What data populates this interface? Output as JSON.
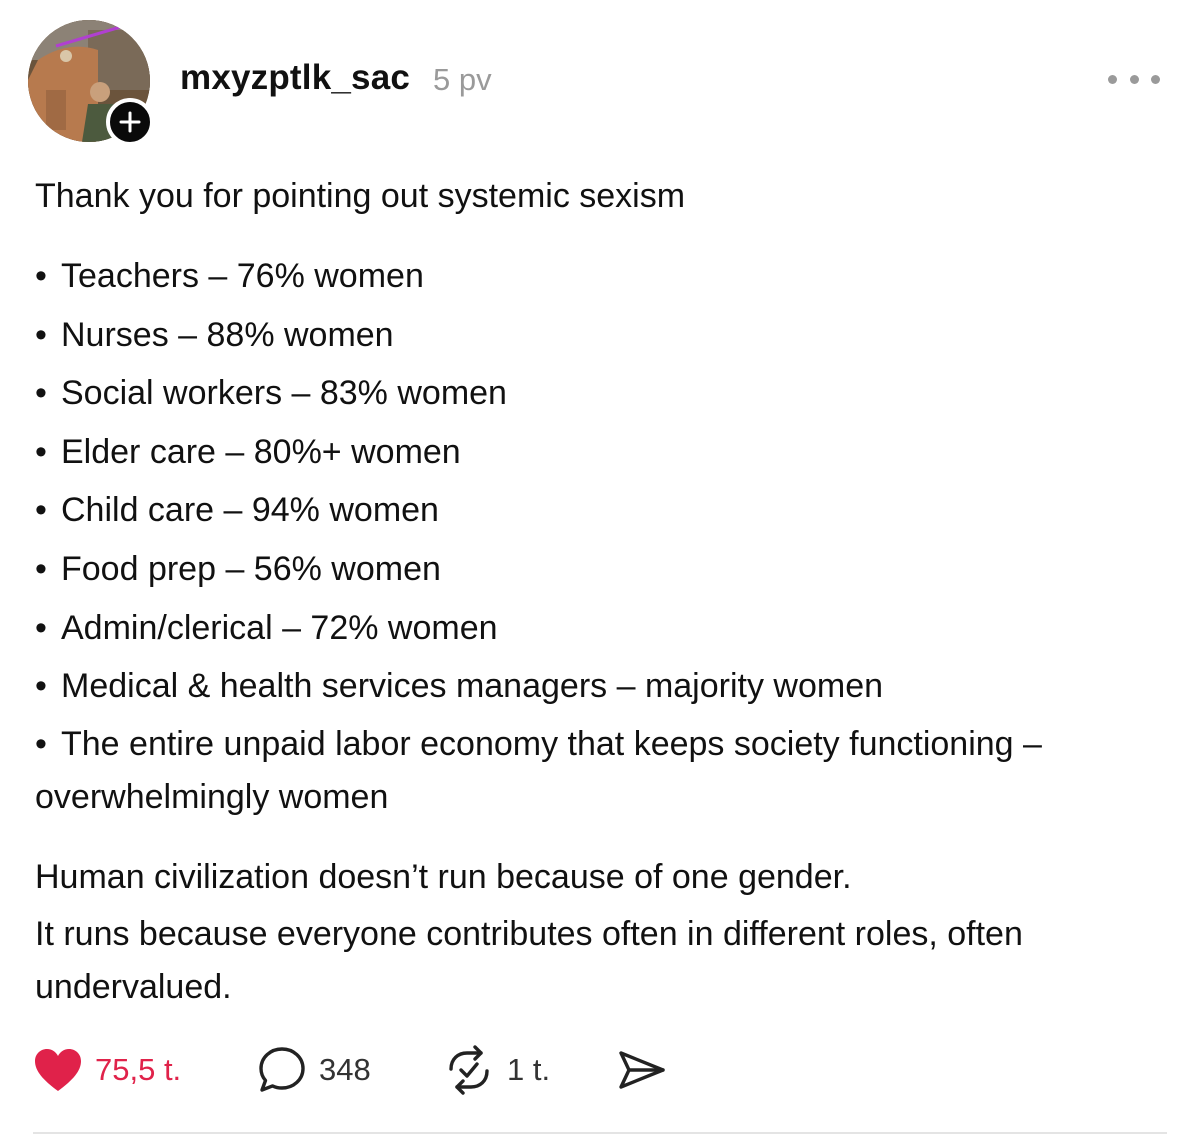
{
  "post": {
    "username": "mxyzptlk_sac",
    "timestamp": "5 pv",
    "intro": "Thank you for pointing out systemic sexism",
    "bullets": [
      "Teachers – 76% women",
      "Nurses – 88% women",
      "Social workers – 83% women",
      "Elder care – 80%+ women",
      "Child care – 94% women",
      "Food prep – 56% women",
      "Admin/clerical – 72% women",
      "Medical & health services managers – majority women",
      "The entire unpaid labor economy that keeps society functioning – overwhelmingly women"
    ],
    "bullet_marker": "•",
    "outro_line1": "Human civilization doesn’t run because of one gender.",
    "outro_line2": "It runs because everyone contributes often in different roles, often undervalued."
  },
  "actions": {
    "likes": "75,5 t.",
    "replies": "348",
    "reposts": "1 t."
  },
  "colors": {
    "like_red": "#e0224a",
    "muted_gray": "#9a9a9a",
    "text": "#111111"
  },
  "icons": {
    "avatar": "avatar-photo",
    "follow": "plus-icon",
    "more": "more-dots-icon",
    "like": "heart-filled-icon",
    "reply": "speech-bubble-icon",
    "repost": "repost-icon",
    "share": "send-icon"
  }
}
